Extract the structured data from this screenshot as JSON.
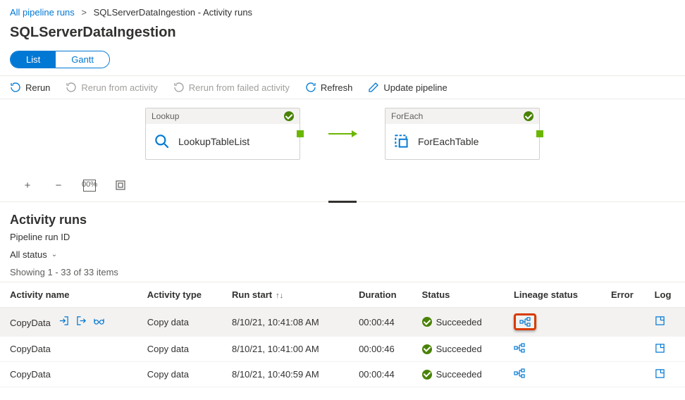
{
  "breadcrumb": {
    "root": "All pipeline runs",
    "current": "SQLServerDataIngestion - Activity runs"
  },
  "page_title": "SQLServerDataIngestion",
  "view_toggle": {
    "list": "List",
    "gantt": "Gantt"
  },
  "toolbar": {
    "rerun": "Rerun",
    "rerun_activity": "Rerun from activity",
    "rerun_failed": "Rerun from failed activity",
    "refresh": "Refresh",
    "update": "Update pipeline"
  },
  "activities": {
    "lookup_type": "Lookup",
    "lookup_name": "LookupTableList",
    "foreach_type": "ForEach",
    "foreach_name": "ForEachTable"
  },
  "section": {
    "title": "Activity runs",
    "subhead": "Pipeline run ID",
    "status_filter": "All status",
    "showing_prefix": "Showing 1",
    "showing_suffix": " - 33 of 33 items"
  },
  "columns": {
    "activity_name": "Activity name",
    "activity_type": "Activity type",
    "run_start": "Run start",
    "duration": "Duration",
    "status": "Status",
    "lineage": "Lineage status",
    "error": "Error",
    "log": "Log"
  },
  "rows": [
    {
      "name": "CopyData",
      "type": "Copy data",
      "start": "8/10/21, 10:41:08 AM",
      "duration": "00:00:44",
      "status": "Succeeded",
      "highlight": true,
      "hovered": true
    },
    {
      "name": "CopyData",
      "type": "Copy data",
      "start": "8/10/21, 10:41:00 AM",
      "duration": "00:00:46",
      "status": "Succeeded",
      "highlight": false,
      "hovered": false
    },
    {
      "name": "CopyData",
      "type": "Copy data",
      "start": "8/10/21, 10:40:59 AM",
      "duration": "00:00:44",
      "status": "Succeeded",
      "highlight": false,
      "hovered": false
    }
  ]
}
